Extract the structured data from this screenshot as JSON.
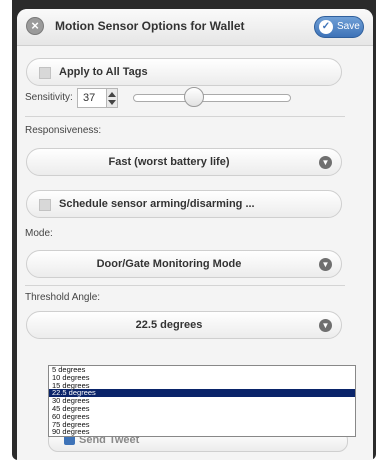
{
  "header": {
    "title": "Motion Sensor Options for Wallet",
    "save_label": "Save",
    "close_glyph": "×",
    "save_icon": "check-icon"
  },
  "apply_all": {
    "label": "Apply to All Tags",
    "checked": false
  },
  "sensitivity": {
    "label": "Sensitivity:",
    "value": "37",
    "slider_level": 0.37
  },
  "responsiveness": {
    "label": "Responsiveness:",
    "value": "Fast (worst battery life)"
  },
  "schedule": {
    "label": "Schedule sensor arming/disarming ...",
    "checked": false
  },
  "mode": {
    "label": "Mode:",
    "value": "Door/Gate Monitoring Mode"
  },
  "threshold": {
    "label": "Threshold Angle:",
    "value": "22.5 degrees",
    "options": [
      "5 degrees",
      "10 degrees",
      "15 degrees",
      "22.5 degrees",
      "30 degrees",
      "45 degrees",
      "60 degrees",
      "75 degrees",
      "90 degrees"
    ],
    "selected_index": 3
  },
  "obscured_option": {
    "label": "Send Tweet",
    "checked": true
  }
}
